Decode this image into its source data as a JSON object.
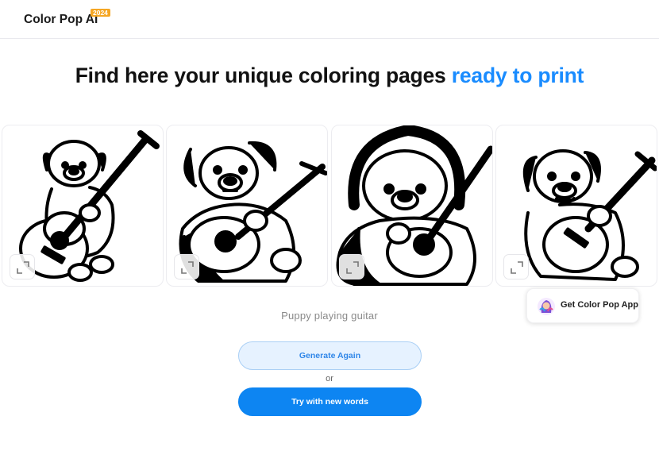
{
  "header": {
    "logo_text": "Color Pop AI",
    "logo_badge": "2024"
  },
  "hero": {
    "title_main": "Find here your unique coloring pages",
    "title_accent": "ready to print",
    "accent_color": "#1a8cff"
  },
  "gallery": {
    "images": [
      {
        "subject": "puppy with guitar",
        "expand_icon": "expand-icon"
      },
      {
        "subject": "puppy with guitar",
        "expand_icon": "expand-icon"
      },
      {
        "subject": "puppy in hood with guitar",
        "expand_icon": "expand-icon"
      },
      {
        "subject": "puppy with guitar",
        "expand_icon": "expand-icon"
      }
    ]
  },
  "app_promo": {
    "label": "Get Color Pop App"
  },
  "prompt_text": "Puppy playing guitar",
  "actions": {
    "generate_again": "Generate Again",
    "or": "or",
    "try_new_words": "Try with new words",
    "primary_color": "#0d85f2"
  }
}
